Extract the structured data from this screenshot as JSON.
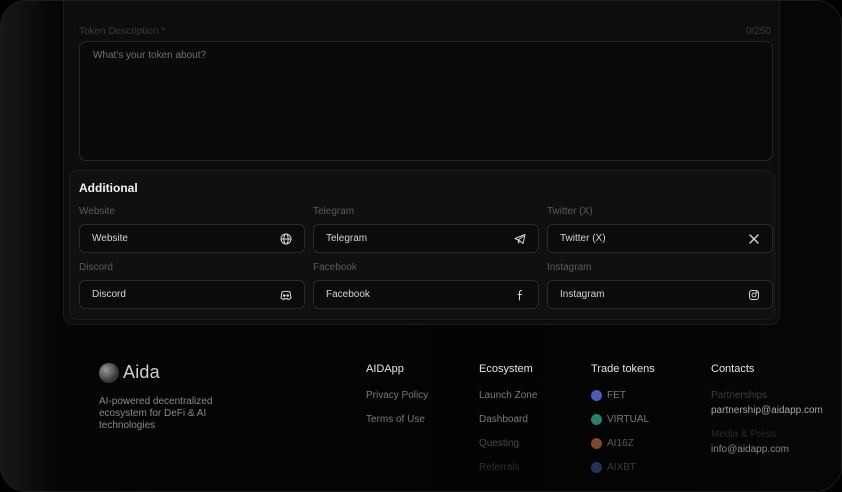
{
  "description": {
    "label": "Token Description *",
    "counter": "0/250",
    "placeholder": "What's your token about?"
  },
  "additional": {
    "title": "Additional",
    "fields": [
      {
        "label": "Website",
        "placeholder": "Website",
        "icon": "globe-icon"
      },
      {
        "label": "Telegram",
        "placeholder": "Telegram",
        "icon": "telegram-icon"
      },
      {
        "label": "Twitter (X)",
        "placeholder": "Twitter (X)",
        "icon": "x-icon"
      },
      {
        "label": "Discord",
        "placeholder": "Discord",
        "icon": "discord-icon"
      },
      {
        "label": "Facebook",
        "placeholder": "Facebook",
        "icon": "facebook-icon"
      },
      {
        "label": "Instagram",
        "placeholder": "Instagram",
        "icon": "instagram-icon"
      }
    ]
  },
  "footer": {
    "logo_text": "Aida",
    "tagline": "AI-powered decentralized ecosystem for DeFi & AI technologies",
    "columns": {
      "aidapp": {
        "title": "AIDApp",
        "links": [
          "Privacy Policy",
          "Terms of Use"
        ]
      },
      "ecosystem": {
        "title": "Ecosystem",
        "links": [
          "Launch Zone",
          "Dashboard",
          "Questing",
          "Referrals"
        ]
      },
      "trade": {
        "title": "Trade tokens",
        "tokens": [
          {
            "symbol": "FET",
            "color": "#5b6ad0"
          },
          {
            "symbol": "VIRTUAL",
            "color": "#3c8f7c"
          },
          {
            "symbol": "AI16Z",
            "color": "#b06a3a"
          },
          {
            "symbol": "AIXBT",
            "color": "#3b4a8a"
          }
        ]
      },
      "contacts": {
        "title": "Contacts",
        "items": [
          {
            "label": "Partnerships",
            "value": "partnership@aidapp.com"
          },
          {
            "label": "Media & Press",
            "value": "info@aidapp.com"
          }
        ]
      }
    }
  }
}
